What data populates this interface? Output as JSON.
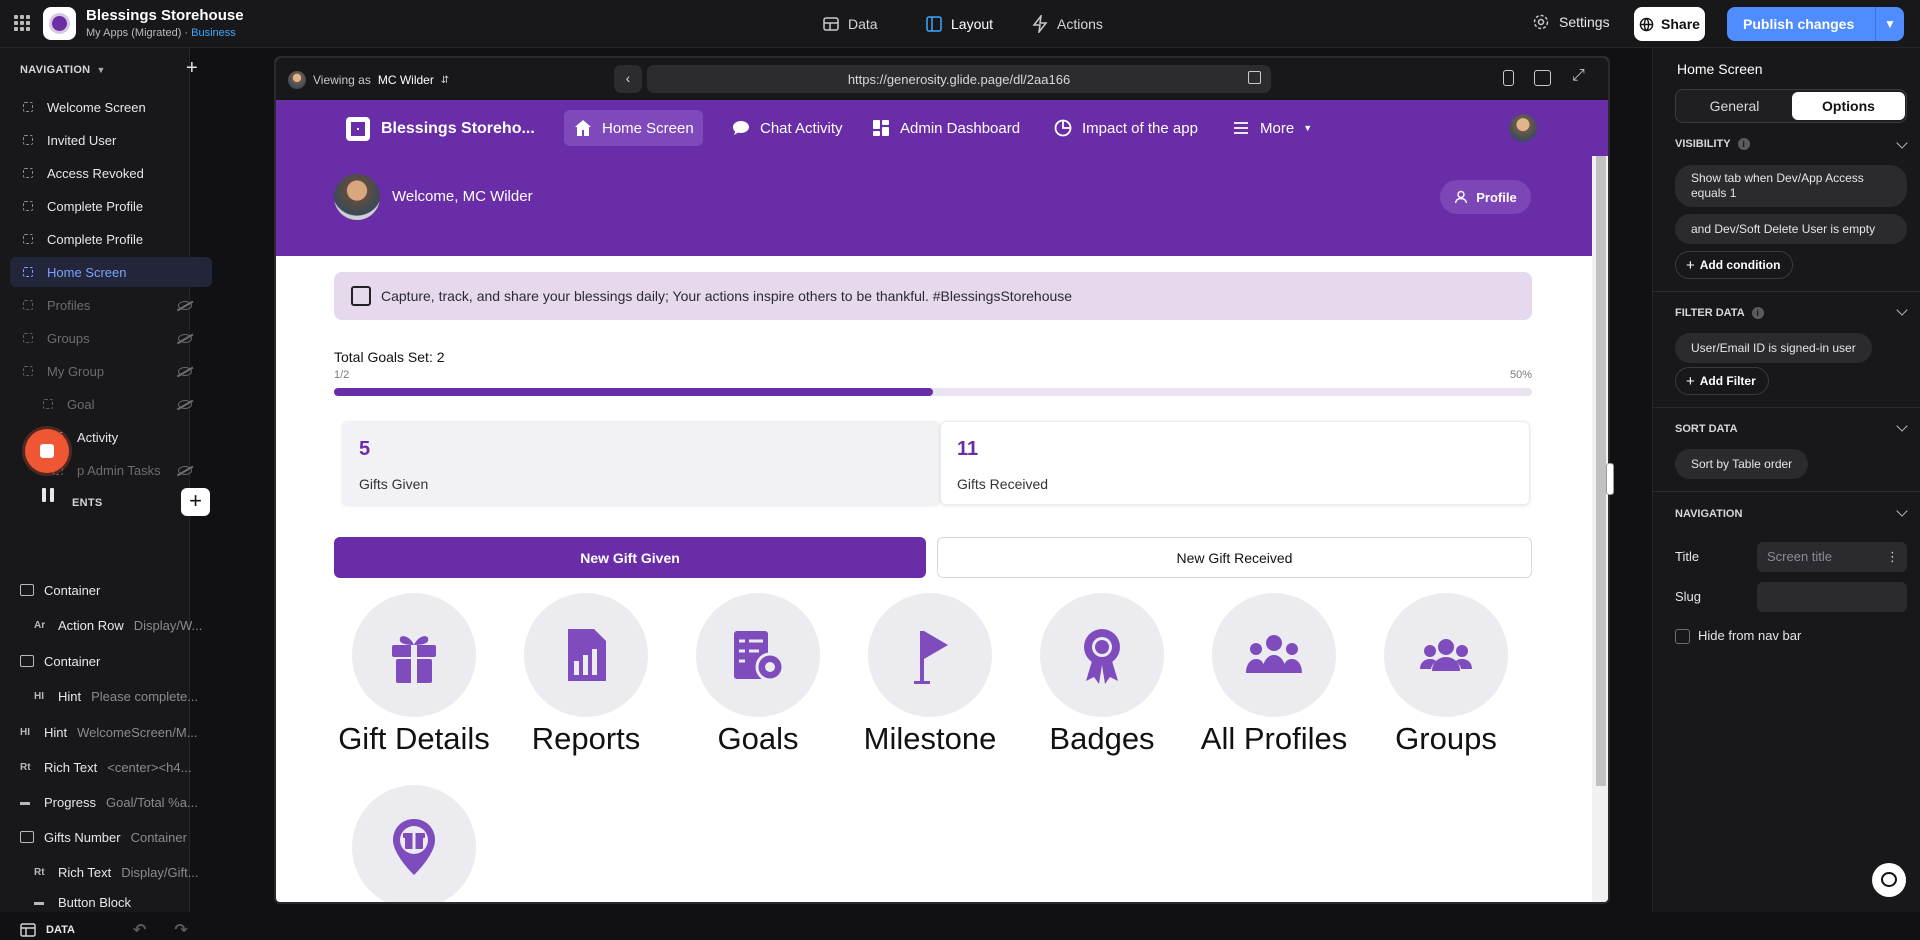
{
  "topbar": {
    "app_title": "Blessings Storehouse",
    "app_subtitle_prefix": "My Apps (Migrated) · ",
    "app_plan": "Business",
    "tabs": [
      {
        "label": "Data",
        "icon": "table-icon"
      },
      {
        "label": "Layout",
        "icon": "layout-icon",
        "active": true
      },
      {
        "label": "Actions",
        "icon": "lightning-icon"
      }
    ],
    "settings_label": "Settings",
    "share_label": "Share",
    "publish_label": "Publish changes"
  },
  "sidebar": {
    "navigation_header": "NAVIGATION",
    "screens": [
      {
        "label": "Welcome Screen",
        "hidden": false
      },
      {
        "label": "Invited User",
        "hidden": false
      },
      {
        "label": "Access Revoked",
        "hidden": false
      },
      {
        "label": "Complete Profile",
        "hidden": false
      },
      {
        "label": "Complete Profile",
        "hidden": false
      },
      {
        "label": "Home Screen",
        "hidden": false,
        "active": true
      },
      {
        "label": "Profiles",
        "hidden": true
      },
      {
        "label": "Groups",
        "hidden": true
      },
      {
        "label": "My Group",
        "hidden": true
      },
      {
        "label": "Goal",
        "hidden": true
      },
      {
        "label": "Activity",
        "hidden": false
      },
      {
        "label": "p Admin Tasks",
        "hidden": true
      }
    ],
    "components_header": "ENTS",
    "components": [
      {
        "type": "Container",
        "detail": ""
      },
      {
        "type": "Action Row",
        "detail": "Display/W..."
      },
      {
        "type": "Container",
        "detail": ""
      },
      {
        "type": "Hint",
        "detail": "Please complete..."
      },
      {
        "type": "Hint",
        "detail": "WelcomeScreen/M..."
      },
      {
        "type": "Rich Text",
        "detail": "<center><h4..."
      },
      {
        "type": "Progress",
        "detail": "Goal/Total %a..."
      },
      {
        "type": "Gifts Number",
        "detail": "Container"
      },
      {
        "type": "Rich Text",
        "detail": "Display/Gift..."
      },
      {
        "type": "Button Block",
        "detail": ""
      }
    ],
    "footer_label": "DATA"
  },
  "preview": {
    "viewing_prefix": "Viewing as",
    "viewing_user": "MC Wilder",
    "url": "https://generosity.glide.page/dl/2aa166",
    "app": {
      "brand": "Blessings Storeho...",
      "nav": [
        {
          "label": "Home Screen",
          "icon": "home-icon",
          "active": true
        },
        {
          "label": "Chat Activity",
          "icon": "chat-icon"
        },
        {
          "label": "Admin Dashboard",
          "icon": "dashboard-icon"
        },
        {
          "label": "Impact of the app",
          "icon": "pie-chart-icon"
        },
        {
          "label": "More",
          "icon": "menu-icon"
        }
      ],
      "welcome": "Welcome, MC Wilder",
      "profile_button": "Profile",
      "hint_text": "Capture, track, and share your blessings daily; Your actions inspire others to be thankful. #BlessingsStorehouse",
      "progress": {
        "title": "Total Goals Set: 2",
        "left_label": "1/2",
        "right_label": "50%",
        "value": 0.5
      },
      "stats": [
        {
          "number": "5",
          "label": "Gifts Given"
        },
        {
          "number": "11",
          "label": "Gifts Received"
        }
      ],
      "buttons": {
        "primary": "New Gift Given",
        "secondary": "New Gift Received"
      },
      "tiles": [
        {
          "label": "Gift Details",
          "icon": "gift-icon"
        },
        {
          "label": "Reports",
          "icon": "report-icon"
        },
        {
          "label": "Goals",
          "icon": "goals-checklist-icon"
        },
        {
          "label": "Milestone",
          "icon": "flag-icon"
        },
        {
          "label": "Badges",
          "icon": "badge-ribbon-icon"
        },
        {
          "label": "All Profiles",
          "icon": "people-group-icon"
        },
        {
          "label": "Groups",
          "icon": "users-icon"
        },
        {
          "label": "",
          "icon": "gift-location-pin-icon"
        }
      ]
    }
  },
  "panel": {
    "title": "Home Screen",
    "tabs": [
      "General",
      "Options"
    ],
    "active_tab": "Options",
    "visibility": {
      "header": "VISIBILITY",
      "conditions": [
        "Show tab when Dev/App Access equals 1",
        "and Dev/Soft Delete User is empty"
      ],
      "add_label": "Add condition"
    },
    "filter": {
      "header": "FILTER DATA",
      "conditions": [
        "User/Email ID is signed-in user"
      ],
      "add_label": "Add Filter"
    },
    "sort": {
      "header": "SORT DATA",
      "value": "Sort by Table order"
    },
    "navigation": {
      "header": "NAVIGATION",
      "title_label": "Title",
      "title_placeholder": "Screen title",
      "slug_label": "Slug",
      "hide_label": "Hide from nav bar"
    }
  }
}
